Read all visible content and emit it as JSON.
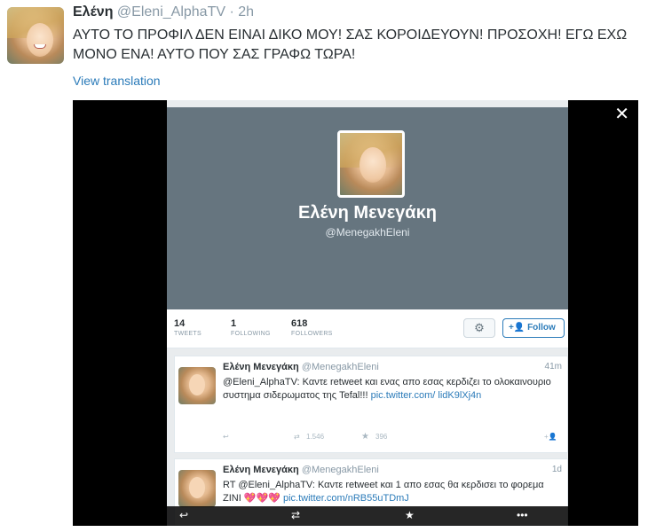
{
  "tweet": {
    "name": "Ελένη",
    "handle": "@Eleni_AlphaTV",
    "separator": "·",
    "time": "2h",
    "text": "ΑΥΤΟ ΤΟ ΠΡΟΦΙΛ ΔΕΝ ΕΙΝΑΙ ΔΙΚΟ ΜΟΥ! ΣΑΣ ΚΟΡΟΙΔΕΥΟΥΝ! ΠΡΟΣΟΧΗ! ΕΓΩ ΕΧΩ ΜΟΝΟ ΕΝΑ! ΑΥΤΟ ΠΟΥ ΣΑΣ ΓΡΑΦΩ ΤΩΡΑ!",
    "translate_label": "View translation"
  },
  "media": {
    "close_glyph": "✕",
    "profile": {
      "name": "Ελένη Μενεγάκη",
      "handle": "@MenegakhEleni",
      "stats": [
        {
          "num": "14",
          "label": "TWEETS"
        },
        {
          "num": "1",
          "label": "FOLLOWING"
        },
        {
          "num": "618",
          "label": "FOLLOWERS"
        }
      ],
      "settings_glyph": "⚙",
      "follow_label": "Follow",
      "follow_glyph": "+👤"
    },
    "posts": [
      {
        "name": "Ελένη Μενεγάκη",
        "handle": "@MenegakhEleni",
        "time": "41m",
        "text": "@Eleni_AlphaTV: Καντε retweet και ενας απο εσας κερδιζει το ολοκαινουριο συστημα σιδερωματος της Tefal!!!",
        "link": "pic.twitter.com/ lidK9lXj4n",
        "reply_glyph": "↩",
        "retweet_count": "1.546",
        "retweet_glyph": "⇄",
        "fav_count": "396",
        "fav_glyph": "★",
        "follow_glyph": "+👤"
      },
      {
        "name": "Ελένη Μενεγάκη",
        "handle": "@MenegakhEleni",
        "time": "1d",
        "text": "RT @Eleni_AlphaTV: Καντε retweet και 1 απο εσας θα κερδισει το φορεμα ΖΙΝΙ 💖💖💖",
        "link": "pic.twitter.com/nRB55uTDmJ"
      }
    ],
    "bottom_bar": {
      "reply_glyph": "↩",
      "retweet_glyph": "⇄",
      "fav_glyph": "★",
      "more_glyph": "•••"
    }
  }
}
